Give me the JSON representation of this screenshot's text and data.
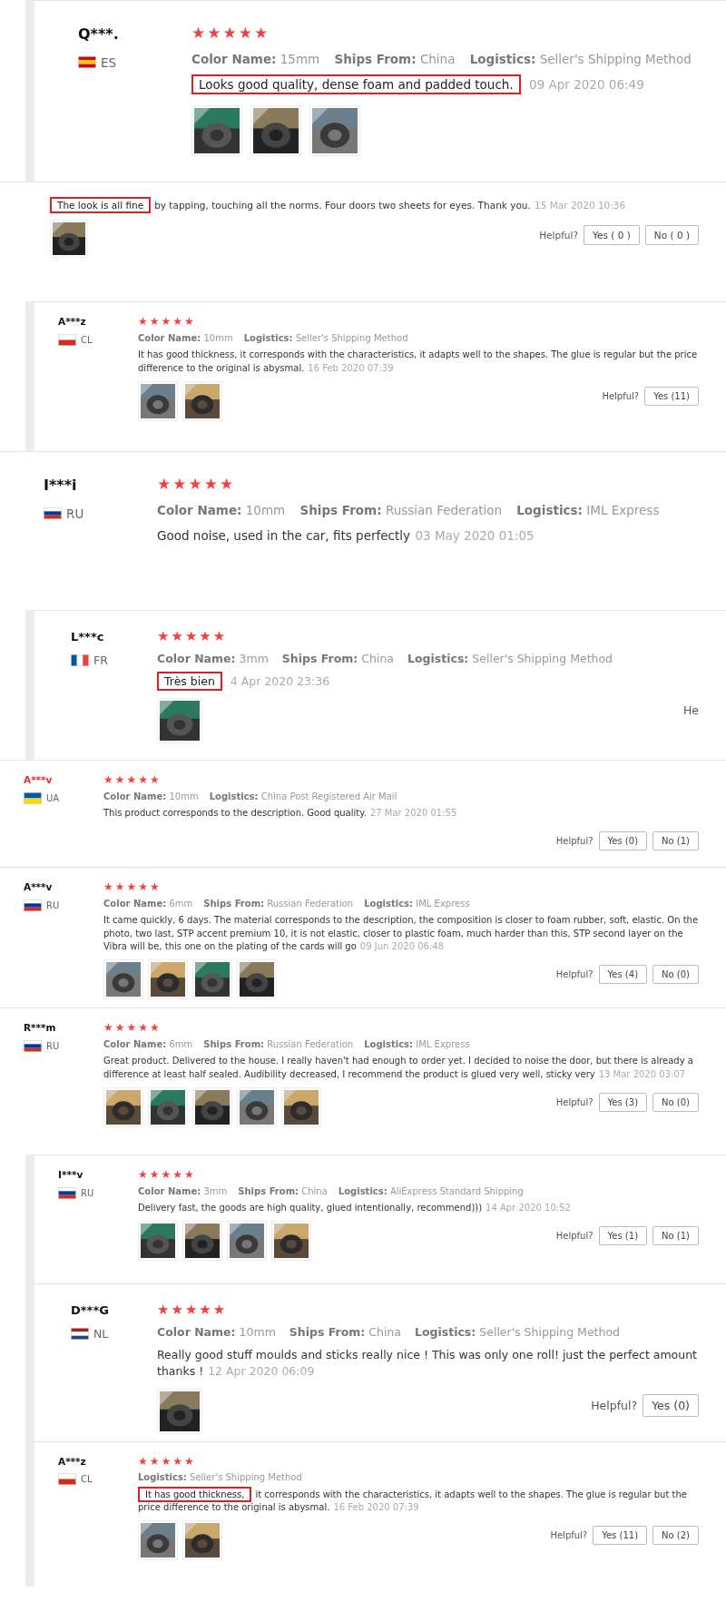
{
  "reviews": [
    {
      "kind": "large",
      "left_edge": true,
      "name": "Q***.",
      "country": "ES",
      "flag": {
        "kind": "horizontal",
        "stripes": [
          {
            "color": "#c60b1e"
          },
          {
            "color": "#ffc400"
          },
          {
            "color": "#c60b1e"
          }
        ]
      },
      "stars": 5,
      "meta": [
        {
          "label": "Color Name:",
          "value": "15mm"
        },
        {
          "label": "Ships From:",
          "value": "China"
        },
        {
          "label": "Logistics:",
          "value": "Seller's Shipping Method"
        }
      ],
      "highlight": "Looks good quality, dense foam and padded touch.",
      "date": "09 Apr 2020 06:49",
      "images": [
        {
          "kind": "picture"
        },
        {
          "kind": "picture"
        },
        {
          "kind": "picture"
        }
      ]
    },
    {
      "kind": "fragment",
      "left_edge": false,
      "highlight": "The look is all fine",
      "comment": "by tapping, touching all the norms. Four doors two sheets for eyes. Thank you.",
      "date": "15 Mar 2020 10:36",
      "images": [
        {
          "kind": "picture"
        }
      ],
      "helpful": "Helpful?",
      "buttons": [
        "Yes ( 0 )",
        "No ( 0 )"
      ]
    },
    {
      "kind": "small",
      "left_edge": true,
      "name": "A***z",
      "country": "CL",
      "flag": {
        "kind": "horizontal",
        "stripes": [
          {
            "color": "#ffffff"
          },
          {
            "color": "#d52b1e"
          }
        ]
      },
      "stars": 5,
      "meta": [
        {
          "label": "Color Name:",
          "value": "10mm"
        },
        {
          "label": "Logistics:",
          "value": "Seller's Shipping Method"
        }
      ],
      "comment": "It has good thickness, it corresponds with the characteristics, it adapts well to the shapes. The glue is regular but the price difference to the original is abysmal.",
      "date": "16 Feb 2020 07:39",
      "images": [
        {
          "kind": "picture"
        },
        {
          "kind": "picture"
        }
      ],
      "helpful": "Helpful?",
      "buttons": [
        "Yes (11)"
      ]
    },
    {
      "kind": "large",
      "left_edge": false,
      "name": "I***i",
      "country": "RU",
      "flag": {
        "kind": "horizontal",
        "stripes": [
          {
            "color": "#ffffff"
          },
          {
            "color": "#0039a6"
          },
          {
            "color": "#d52b1e"
          }
        ]
      },
      "stars": 5,
      "meta": [
        {
          "label": "Color Name:",
          "value": "10mm"
        },
        {
          "label": "Ships From:",
          "value": "Russian Federation"
        },
        {
          "label": "Logistics:",
          "value": "IML Express"
        }
      ],
      "comment": "Good noise, used in the car, fits perfectly",
      "date": "03 May 2020 01:05"
    },
    {
      "kind": "medium",
      "left_edge": true,
      "name": "L***c",
      "country": "FR",
      "flag": {
        "kind": "vertical",
        "stripes": [
          {
            "color": "#0055a4"
          },
          {
            "color": "#ffffff"
          },
          {
            "color": "#ef4135"
          }
        ]
      },
      "stars": 5,
      "meta": [
        {
          "label": "Color Name:",
          "value": "3mm"
        },
        {
          "label": "Ships From:",
          "value": "China"
        },
        {
          "label": "Logistics:",
          "value": "Seller's Shipping Method"
        }
      ],
      "highlight": "Très bien",
      "date": "4 Apr 2020 23:36",
      "images": [
        {
          "kind": "picture"
        }
      ],
      "helpful": "He"
    },
    {
      "kind": "small",
      "left_edge": false,
      "name": "A***v",
      "name_alert": true,
      "country": "UA",
      "flag": {
        "kind": "horizontal",
        "stripes": [
          {
            "color": "#0057b7"
          },
          {
            "color": "#ffd700"
          }
        ]
      },
      "stars": 5,
      "meta": [
        {
          "label": "Color Name:",
          "value": "10mm"
        },
        {
          "label": "Logistics:",
          "value": "China Post Registered Air Mail"
        }
      ],
      "comment": "This product corresponds to the description. Good quality.",
      "date": "27 Mar 2020 01:55",
      "helpful": "Helpful?",
      "buttons": [
        "Yes (0)",
        "No (1)"
      ]
    },
    {
      "kind": "small",
      "left_edge": false,
      "name": "A***v",
      "country": "RU",
      "flag": {
        "kind": "horizontal",
        "stripes": [
          {
            "color": "#ffffff"
          },
          {
            "color": "#0039a6"
          },
          {
            "color": "#d52b1e"
          }
        ]
      },
      "stars": 5,
      "meta": [
        {
          "label": "Color Name:",
          "value": "6mm"
        },
        {
          "label": "Ships From:",
          "value": "Russian Federation"
        },
        {
          "label": "Logistics:",
          "value": "IML Express"
        }
      ],
      "comment": "It came quickly, 6 days. The material corresponds to the description, the composition is closer to foam rubber, soft, elastic. On the photo, two last, STP accent premium 10, it is not elastic, closer to plastic foam, much harder than this, STP second layer on the Vibra will be, this one on the plating of the cards will go",
      "date": "09 Jun 2020 06:48",
      "images": [
        {
          "kind": "picture"
        },
        {
          "kind": "picture"
        },
        {
          "kind": "picture"
        },
        {
          "kind": "picture"
        }
      ],
      "helpful": "Helpful?",
      "buttons": [
        "Yes (4)",
        "No (0)"
      ]
    },
    {
      "kind": "small",
      "left_edge": false,
      "name": "R***m",
      "country": "RU",
      "flag": {
        "kind": "horizontal",
        "stripes": [
          {
            "color": "#ffffff"
          },
          {
            "color": "#0039a6"
          },
          {
            "color": "#d52b1e"
          }
        ]
      },
      "stars": 5,
      "meta": [
        {
          "label": "Color Name:",
          "value": "6mm"
        },
        {
          "label": "Ships From:",
          "value": "Russian Federation"
        },
        {
          "label": "Logistics:",
          "value": "IML Express"
        }
      ],
      "comment": "Great product. Delivered to the house. I really haven't had enough to order yet. I decided to noise the door, but there is already a difference at least half sealed. Audibility decreased, I recommend the product is glued very well, sticky very",
      "date": "13 Mar 2020 03:07",
      "images": [
        {
          "kind": "picture"
        },
        {
          "kind": "picture"
        },
        {
          "kind": "picture"
        },
        {
          "kind": "picture"
        },
        {
          "kind": "picture"
        }
      ],
      "helpful": "Helpful?",
      "buttons": [
        "Yes (3)",
        "No (0)"
      ]
    },
    {
      "kind": "small",
      "left_edge": true,
      "name": "I***v",
      "country": "RU",
      "flag": {
        "kind": "horizontal",
        "stripes": [
          {
            "color": "#ffffff"
          },
          {
            "color": "#0039a6"
          },
          {
            "color": "#d52b1e"
          }
        ]
      },
      "stars": 5,
      "meta": [
        {
          "label": "Color Name:",
          "value": "3mm"
        },
        {
          "label": "Ships From:",
          "value": "China"
        },
        {
          "label": "Logistics:",
          "value": "AliExpress Standard Shipping"
        }
      ],
      "comment": "Delivery fast, the goods are high quality, glued intentionally, recommend)))",
      "date": "14 Apr 2020 10:52",
      "images": [
        {
          "kind": "picture"
        },
        {
          "kind": "picture"
        },
        {
          "kind": "picture"
        },
        {
          "kind": "picture"
        }
      ],
      "helpful": "Helpful?",
      "buttons": [
        "Yes (1)",
        "No (1)"
      ]
    },
    {
      "kind": "medium",
      "left_edge": true,
      "name": "D***G",
      "country": "NL",
      "flag": {
        "kind": "horizontal",
        "stripes": [
          {
            "color": "#ae1c28"
          },
          {
            "color": "#ffffff"
          },
          {
            "color": "#21468b"
          }
        ]
      },
      "stars": 5,
      "meta": [
        {
          "label": "Color Name:",
          "value": "10mm"
        },
        {
          "label": "Ships From:",
          "value": "China"
        },
        {
          "label": "Logistics:",
          "value": "Seller's Shipping Method"
        }
      ],
      "comment": "Really good stuff moulds and sticks really nice ! This was only one roll! just the perfect amount thanks !",
      "date": "12 Apr 2020 06:09",
      "images": [
        {
          "kind": "picture"
        }
      ],
      "helpful": "Helpful?",
      "buttons": [
        "Yes (0)"
      ]
    },
    {
      "kind": "small",
      "left_edge": true,
      "name": "A***z",
      "country": "CL",
      "flag": {
        "kind": "horizontal",
        "stripes": [
          {
            "color": "#ffffff"
          },
          {
            "color": "#d52b1e"
          }
        ]
      },
      "stars": 5,
      "meta": [
        {
          "label": "Logistics:",
          "value": "Seller's Shipping Method"
        }
      ],
      "highlight": "It has good thickness,",
      "comment": "it corresponds with the characteristics, it adapts well to the shapes. The glue is regular but the price difference to the original is abysmal.",
      "date": "16 Feb 2020 07:39",
      "images": [
        {
          "kind": "picture"
        },
        {
          "kind": "picture"
        }
      ],
      "helpful": "Helpful?",
      "buttons": [
        "Yes (11)",
        "No (2)"
      ]
    }
  ]
}
